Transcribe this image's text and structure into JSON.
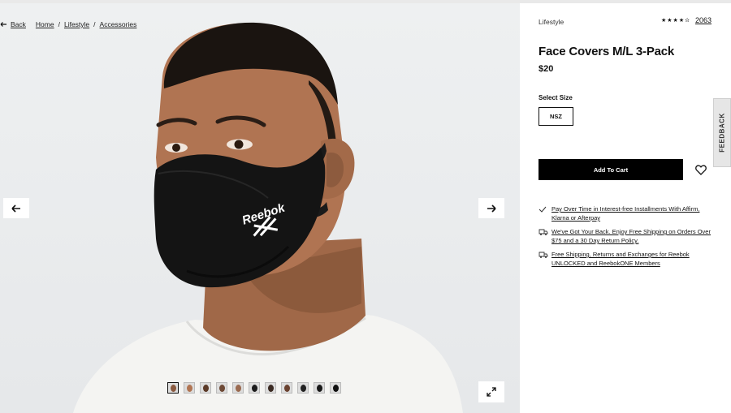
{
  "breadcrumb": {
    "back_label": "Back",
    "items": [
      "Home",
      "Lifestyle",
      "Accessories"
    ]
  },
  "gallery": {
    "brand_on_mask": "Reebok",
    "thumbnail_count": 11,
    "active_thumbnail": 1
  },
  "product": {
    "category": "Lifestyle",
    "rating_stars": "★★★★✫",
    "review_count": "2063",
    "title": "Face Covers M/L 3-Pack",
    "price": "$20",
    "size_label": "Select Size",
    "size_option": "NSZ",
    "add_to_cart_label": "Add To Cart"
  },
  "feedback_label": "FEEDBACK",
  "benefits": [
    {
      "icon": "check-icon",
      "text": "Pay Over Time in Interest-free Installments With Affirm, Klarna or Afterpay"
    },
    {
      "icon": "truck-icon",
      "text": "We've Got Your Back. Enjoy Free Shipping on Orders Over $75 and a 30 Day Return Policy."
    },
    {
      "icon": "truck-icon",
      "text": "Free Shipping, Returns and Exchanges for Reebok UNLOCKED and ReebokONE Members"
    }
  ],
  "colors": {
    "cart_button": "#000000",
    "gallery_bg": "#eceeef",
    "mask": "#141414",
    "skin": "#a86e4e"
  }
}
